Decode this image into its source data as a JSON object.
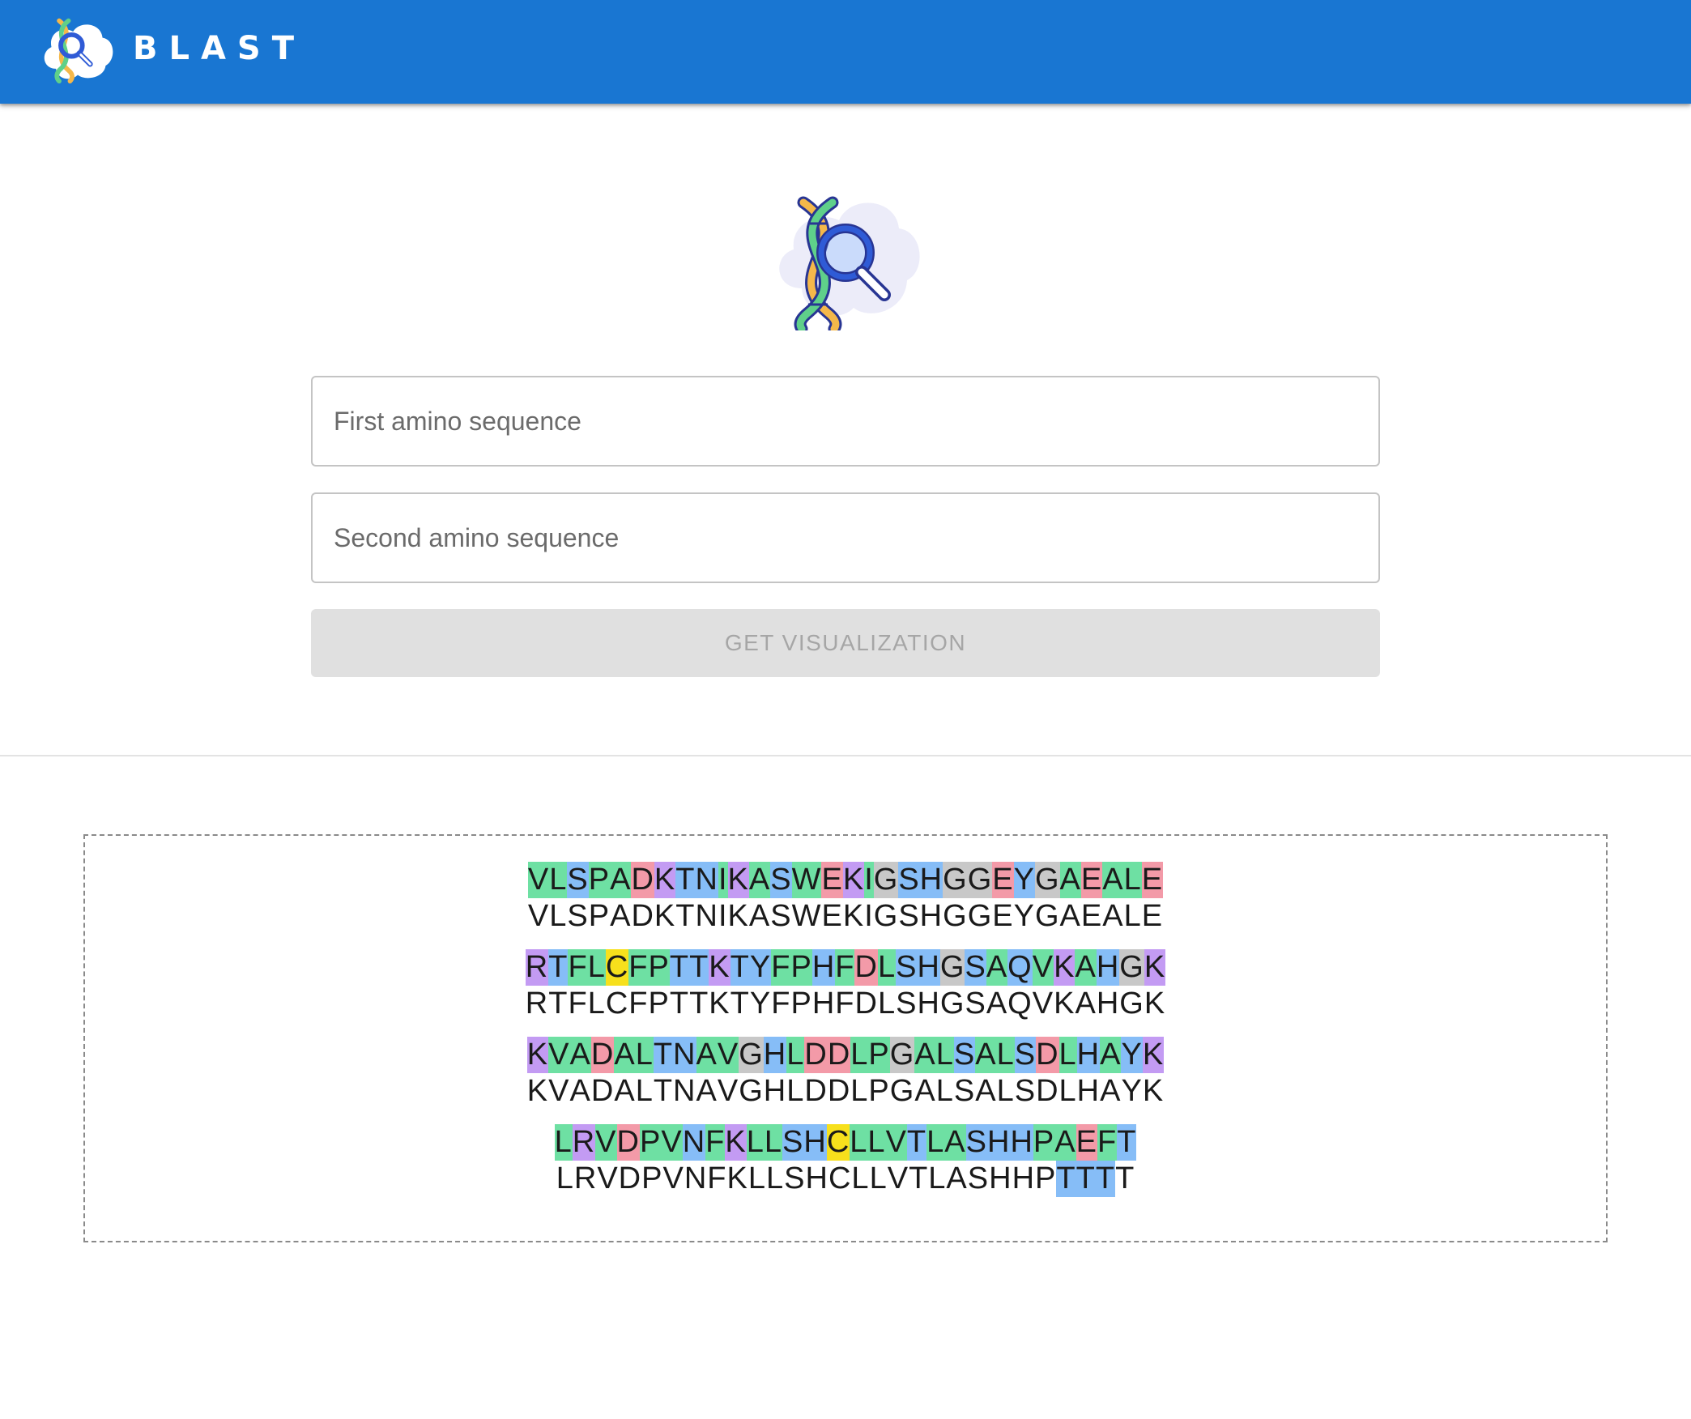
{
  "app": {
    "title": "BLAST"
  },
  "form": {
    "first_placeholder": "First amino sequence",
    "first_value": "",
    "second_placeholder": "Second amino sequence",
    "second_value": "",
    "button_label": "GET VISUALIZATION",
    "button_disabled": true
  },
  "alignment": {
    "color_scheme": {
      "hydrophobic": "#6ee0a3",
      "polar": "#86bdf7",
      "positive": "#c39bf3",
      "negative": "#f39aa8",
      "glycine": "#c8c8c8",
      "cysteine": "#f7e01c"
    },
    "blocks": [
      {
        "top": "VLSPADKTNIKASWEKIGSHGGEYGAEALE",
        "bottom": "VLSPADKTNIKASWEKIGSHGGEYGAEALE"
      },
      {
        "top": "RTFLCFPTTKTYFPHFDLSHGSAQVKAHGK",
        "bottom": "RTFLCFPTTKTYFPHFDLSHGSAQVKAHGK"
      },
      {
        "top": "KVADALTNAVGHLDDLPGALSALSDLHAYK",
        "bottom": "KVADALTNAVGHLDDLPGALSALSDLHAYK"
      },
      {
        "top": "LRVDPVNFKLLSHCLLVTLASHHPAEFT",
        "bottom": "LRVDPVNFKLLSHCLLVTLASHHPTTTT",
        "bottom_highlight_positions": [
          24,
          25,
          26
        ]
      }
    ]
  }
}
